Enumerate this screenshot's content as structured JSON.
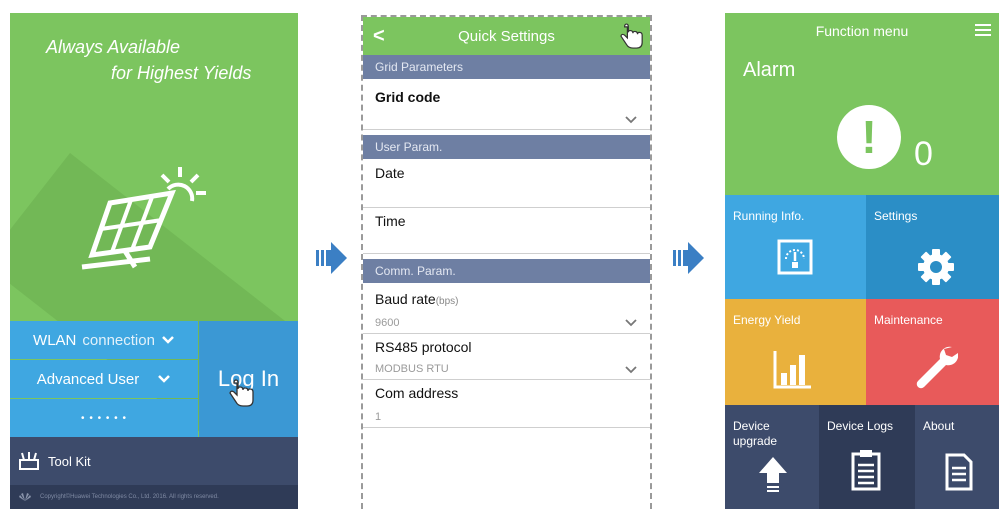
{
  "login_screen": {
    "slogan_line1": "Always Available",
    "slogan_line2": "for Highest Yields",
    "wlan_label": "WLAN",
    "wlan_suffix": "connection",
    "user_role": "Advanced User",
    "password_mask": "• • • • • •",
    "login_button": "Log In",
    "toolkit_label": "Tool Kit",
    "copyright": "Copyright©Huawei Technologies Co., Ltd. 2016. All rights reserved.",
    "icons": {
      "solar": "solar-panel-icon",
      "toolkit": "toolkit-icon",
      "logo": "huawei-logo-icon",
      "hand": "hand-pointer-icon"
    }
  },
  "quick_settings": {
    "title": "Quick Settings",
    "back_glyph": "<",
    "sections": {
      "grid": "Grid Parameters",
      "user": "User Param.",
      "comm": "Comm. Param."
    },
    "fields": {
      "grid_code": {
        "label": "Grid code",
        "value": ""
      },
      "date": {
        "label": "Date"
      },
      "time": {
        "label": "Time"
      },
      "baud_rate": {
        "label": "Baud rate",
        "unit": "(bps)",
        "value": "9600"
      },
      "rs485": {
        "label": "RS485 protocol",
        "value": "MODBUS RTU"
      },
      "com_address": {
        "label": "Com address",
        "value": "1"
      }
    }
  },
  "function_menu": {
    "title": "Function menu",
    "alarm": {
      "label": "Alarm",
      "glyph": "!",
      "count": "0"
    },
    "tiles": {
      "running_info": "Running Info.",
      "settings": "Settings",
      "energy_yield": "Energy Yield",
      "maintenance": "Maintenance",
      "device_upgrade_line1": "Device",
      "device_upgrade_line2": "upgrade",
      "device_logs": "Device Logs",
      "about": "About"
    }
  },
  "colors": {
    "green": "#7cc55f",
    "blue": "#3fa7e1",
    "dark_blue": "#2b8ec6",
    "navy": "#3d4b6b",
    "section_gray": "#6e7fa3",
    "orange": "#e9b13d",
    "red": "#e85a5a"
  }
}
